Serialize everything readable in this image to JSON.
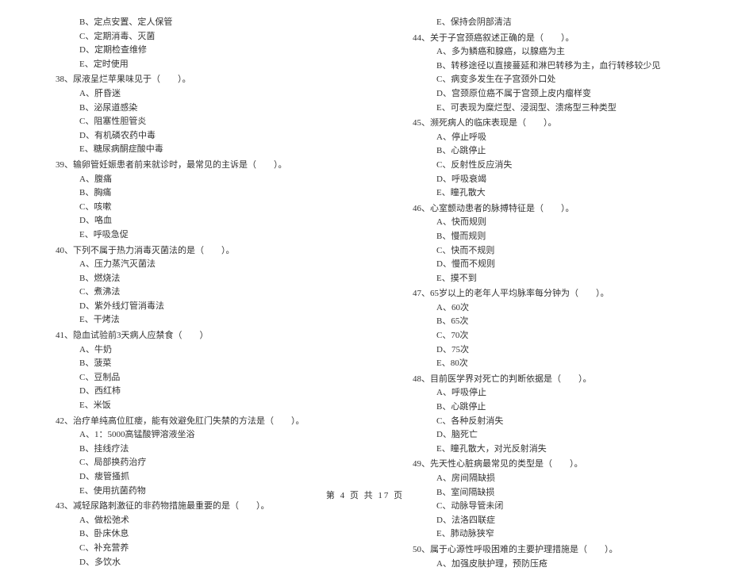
{
  "left_col": {
    "pre_options": [
      "B、定点安置、定人保管",
      "C、定期消毒、灭菌",
      "D、定期检查维修",
      "E、定时使用"
    ],
    "questions": [
      {
        "num": "38、",
        "stem": "尿液呈烂苹果味见于（　　）。",
        "opts": [
          "A、肝昏迷",
          "B、泌尿道感染",
          "C、阻塞性胆管炎",
          "D、有机磷农药中毒",
          "E、糖尿病酮症酸中毒"
        ]
      },
      {
        "num": "39、",
        "stem": "输卵管妊娠患者前来就诊时，最常见的主诉是（　　）。",
        "opts": [
          "A、腹痛",
          "B、胸痛",
          "C、咳嗽",
          "D、咯血",
          "E、呼吸急促"
        ]
      },
      {
        "num": "40、",
        "stem": "下列不属于热力消毒灭菌法的是（　　）。",
        "opts": [
          "A、压力蒸汽灭菌法",
          "B、燃烧法",
          "C、煮沸法",
          "D、紫外线灯管消毒法",
          "E、干烤法"
        ]
      },
      {
        "num": "41、",
        "stem": "隐血试验前3天病人应禁食（　　）",
        "opts": [
          "A、牛奶",
          "B、菠菜",
          "C、豆制品",
          "D、西红柿",
          "E、米饭"
        ]
      },
      {
        "num": "42、",
        "stem": "治疗单纯高位肛瘘，能有效避免肛门失禁的方法是（　　）。",
        "opts": [
          "A、1：5000高锰酸钾溶液坐浴",
          "B、挂线疗法",
          "C、局部换药治疗",
          "D、瘘管搔抓",
          "E、使用抗菌药物"
        ]
      },
      {
        "num": "43、",
        "stem": "减轻尿路刺激征的非药物措施最重要的是（　　）。",
        "opts": [
          "A、做松弛术",
          "B、卧床休息",
          "C、补充营养",
          "D、多饮水"
        ]
      }
    ]
  },
  "right_col": {
    "pre_options": [
      "E、保持会阴部清洁"
    ],
    "questions": [
      {
        "num": "44、",
        "stem": "关于子宫颈癌叙述正确的是（　　）。",
        "opts": [
          "A、多为鳞癌和腺癌，以腺癌为主",
          "B、转移途径以直接蔓延和淋巴转移为主，血行转移较少见",
          "C、病变多发生在子宫颈外口处",
          "D、宫颈原位癌不属于宫颈上皮内瘤样变",
          "E、可表现为糜烂型、浸润型、溃疡型三种类型"
        ]
      },
      {
        "num": "45、",
        "stem": "濒死病人的临床表现是（　　）。",
        "opts": [
          "A、停止呼吸",
          "B、心跳停止",
          "C、反射性反应消失",
          "D、呼吸衰竭",
          "E、瞳孔散大"
        ]
      },
      {
        "num": "46、",
        "stem": "心室颤动患者的脉搏特征是（　　）。",
        "opts": [
          "A、快而规则",
          "B、慢而规则",
          "C、快而不规则",
          "D、慢而不规则",
          "E、摸不到"
        ]
      },
      {
        "num": "47、",
        "stem": "65岁以上的老年人平均脉率每分钟为（　　）。",
        "opts": [
          "A、60次",
          "B、65次",
          "C、70次",
          "D、75次",
          "E、80次"
        ]
      },
      {
        "num": "48、",
        "stem": "目前医学界对死亡的判断依据是（　　）。",
        "opts": [
          "A、呼吸停止",
          "B、心跳停止",
          "C、各种反射消失",
          "D、脑死亡",
          "E、瞳孔散大，对光反射消失"
        ]
      },
      {
        "num": "49、",
        "stem": "先天性心脏病最常见的类型是（　　）。",
        "opts": [
          "A、房间隔缺损",
          "B、室间隔缺损",
          "C、动脉导管未闭",
          "D、法洛四联症",
          "E、肺动脉狭窄"
        ]
      },
      {
        "num": "50、",
        "stem": "属于心源性呼吸困难的主要护理措施是（　　）。",
        "opts": [
          "A、加强皮肤护理，预防压疮"
        ]
      }
    ]
  },
  "footer": "第 4 页 共 17 页"
}
